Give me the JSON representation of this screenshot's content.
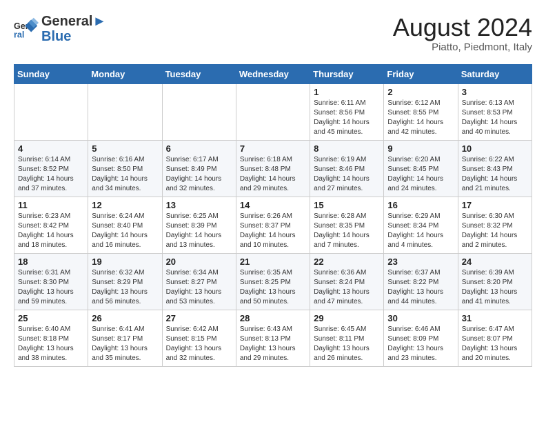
{
  "header": {
    "logo_line1": "General",
    "logo_line2": "Blue",
    "month_year": "August 2024",
    "location": "Piatto, Piedmont, Italy"
  },
  "weekdays": [
    "Sunday",
    "Monday",
    "Tuesday",
    "Wednesday",
    "Thursday",
    "Friday",
    "Saturday"
  ],
  "weeks": [
    [
      {
        "day": "",
        "info": ""
      },
      {
        "day": "",
        "info": ""
      },
      {
        "day": "",
        "info": ""
      },
      {
        "day": "",
        "info": ""
      },
      {
        "day": "1",
        "info": "Sunrise: 6:11 AM\nSunset: 8:56 PM\nDaylight: 14 hours\nand 45 minutes."
      },
      {
        "day": "2",
        "info": "Sunrise: 6:12 AM\nSunset: 8:55 PM\nDaylight: 14 hours\nand 42 minutes."
      },
      {
        "day": "3",
        "info": "Sunrise: 6:13 AM\nSunset: 8:53 PM\nDaylight: 14 hours\nand 40 minutes."
      }
    ],
    [
      {
        "day": "4",
        "info": "Sunrise: 6:14 AM\nSunset: 8:52 PM\nDaylight: 14 hours\nand 37 minutes."
      },
      {
        "day": "5",
        "info": "Sunrise: 6:16 AM\nSunset: 8:50 PM\nDaylight: 14 hours\nand 34 minutes."
      },
      {
        "day": "6",
        "info": "Sunrise: 6:17 AM\nSunset: 8:49 PM\nDaylight: 14 hours\nand 32 minutes."
      },
      {
        "day": "7",
        "info": "Sunrise: 6:18 AM\nSunset: 8:48 PM\nDaylight: 14 hours\nand 29 minutes."
      },
      {
        "day": "8",
        "info": "Sunrise: 6:19 AM\nSunset: 8:46 PM\nDaylight: 14 hours\nand 27 minutes."
      },
      {
        "day": "9",
        "info": "Sunrise: 6:20 AM\nSunset: 8:45 PM\nDaylight: 14 hours\nand 24 minutes."
      },
      {
        "day": "10",
        "info": "Sunrise: 6:22 AM\nSunset: 8:43 PM\nDaylight: 14 hours\nand 21 minutes."
      }
    ],
    [
      {
        "day": "11",
        "info": "Sunrise: 6:23 AM\nSunset: 8:42 PM\nDaylight: 14 hours\nand 18 minutes."
      },
      {
        "day": "12",
        "info": "Sunrise: 6:24 AM\nSunset: 8:40 PM\nDaylight: 14 hours\nand 16 minutes."
      },
      {
        "day": "13",
        "info": "Sunrise: 6:25 AM\nSunset: 8:39 PM\nDaylight: 14 hours\nand 13 minutes."
      },
      {
        "day": "14",
        "info": "Sunrise: 6:26 AM\nSunset: 8:37 PM\nDaylight: 14 hours\nand 10 minutes."
      },
      {
        "day": "15",
        "info": "Sunrise: 6:28 AM\nSunset: 8:35 PM\nDaylight: 14 hours\nand 7 minutes."
      },
      {
        "day": "16",
        "info": "Sunrise: 6:29 AM\nSunset: 8:34 PM\nDaylight: 14 hours\nand 4 minutes."
      },
      {
        "day": "17",
        "info": "Sunrise: 6:30 AM\nSunset: 8:32 PM\nDaylight: 14 hours\nand 2 minutes."
      }
    ],
    [
      {
        "day": "18",
        "info": "Sunrise: 6:31 AM\nSunset: 8:30 PM\nDaylight: 13 hours\nand 59 minutes."
      },
      {
        "day": "19",
        "info": "Sunrise: 6:32 AM\nSunset: 8:29 PM\nDaylight: 13 hours\nand 56 minutes."
      },
      {
        "day": "20",
        "info": "Sunrise: 6:34 AM\nSunset: 8:27 PM\nDaylight: 13 hours\nand 53 minutes."
      },
      {
        "day": "21",
        "info": "Sunrise: 6:35 AM\nSunset: 8:25 PM\nDaylight: 13 hours\nand 50 minutes."
      },
      {
        "day": "22",
        "info": "Sunrise: 6:36 AM\nSunset: 8:24 PM\nDaylight: 13 hours\nand 47 minutes."
      },
      {
        "day": "23",
        "info": "Sunrise: 6:37 AM\nSunset: 8:22 PM\nDaylight: 13 hours\nand 44 minutes."
      },
      {
        "day": "24",
        "info": "Sunrise: 6:39 AM\nSunset: 8:20 PM\nDaylight: 13 hours\nand 41 minutes."
      }
    ],
    [
      {
        "day": "25",
        "info": "Sunrise: 6:40 AM\nSunset: 8:18 PM\nDaylight: 13 hours\nand 38 minutes."
      },
      {
        "day": "26",
        "info": "Sunrise: 6:41 AM\nSunset: 8:17 PM\nDaylight: 13 hours\nand 35 minutes."
      },
      {
        "day": "27",
        "info": "Sunrise: 6:42 AM\nSunset: 8:15 PM\nDaylight: 13 hours\nand 32 minutes."
      },
      {
        "day": "28",
        "info": "Sunrise: 6:43 AM\nSunset: 8:13 PM\nDaylight: 13 hours\nand 29 minutes."
      },
      {
        "day": "29",
        "info": "Sunrise: 6:45 AM\nSunset: 8:11 PM\nDaylight: 13 hours\nand 26 minutes."
      },
      {
        "day": "30",
        "info": "Sunrise: 6:46 AM\nSunset: 8:09 PM\nDaylight: 13 hours\nand 23 minutes."
      },
      {
        "day": "31",
        "info": "Sunrise: 6:47 AM\nSunset: 8:07 PM\nDaylight: 13 hours\nand 20 minutes."
      }
    ]
  ]
}
